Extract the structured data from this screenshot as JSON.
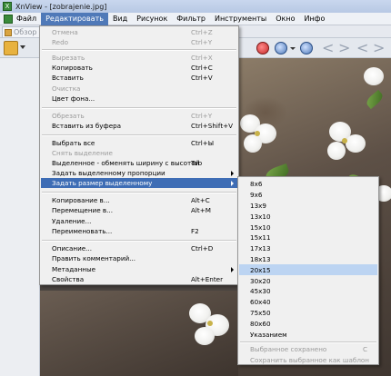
{
  "window": {
    "title": "XnView - [zobrajenie.jpg]"
  },
  "menubar": {
    "items": [
      {
        "label": "Файл",
        "active": false
      },
      {
        "label": "Редактировать",
        "active": true
      },
      {
        "label": "Вид",
        "active": false
      },
      {
        "label": "Рисунок",
        "active": false
      },
      {
        "label": "Фильтр",
        "active": false
      },
      {
        "label": "Инструменты",
        "active": false
      },
      {
        "label": "Окно",
        "active": false
      },
      {
        "label": "Инфо",
        "active": false
      }
    ]
  },
  "tabs": {
    "browser_label": "Обзор"
  },
  "edit_menu": {
    "undo": {
      "label": "Отмена",
      "shortcut": "Ctrl+Z"
    },
    "redo": {
      "label": "Redo",
      "shortcut": "Ctrl+Y"
    },
    "cut": {
      "label": "Вырезать",
      "shortcut": "Ctrl+X"
    },
    "copy": {
      "label": "Копировать",
      "shortcut": "Ctrl+C"
    },
    "paste": {
      "label": "Вставить",
      "shortcut": "Ctrl+V"
    },
    "clear": {
      "label": "Очистка"
    },
    "bg_color": {
      "label": "Цвет фона..."
    },
    "crop": {
      "label": "Обрезать",
      "shortcut": "Ctrl+Y"
    },
    "paste_clipboard": {
      "label": "Вставить из буфера",
      "shortcut": "Ctrl+Shift+V"
    },
    "select_all": {
      "label": "Выбрать все",
      "shortcut": "Ctrl+Ы"
    },
    "deselect": {
      "label": "Снять выделение"
    },
    "swap_selection": {
      "label": "Выделенное - обменять ширину с высотой",
      "shortcut": "Tab"
    },
    "set_ratio": {
      "label": "Задать выделенному пропорции"
    },
    "set_size": {
      "label": "Задать размер выделенному"
    },
    "copy_to": {
      "label": "Копирование в...",
      "shortcut": "Alt+C"
    },
    "move_to": {
      "label": "Перемещение в...",
      "shortcut": "Alt+M"
    },
    "delete": {
      "label": "Удаление..."
    },
    "rename": {
      "label": "Переименовать...",
      "shortcut": "F2"
    },
    "description": {
      "label": "Описание...",
      "shortcut": "Ctrl+D"
    },
    "edit_comment": {
      "label": "Править комментарий..."
    },
    "metadata": {
      "label": "Метаданные"
    },
    "properties": {
      "label": "Свойства",
      "shortcut": "Alt+Enter"
    }
  },
  "size_submenu": {
    "items": [
      "8x6",
      "9x6",
      "13x9",
      "13x10",
      "15x10",
      "15x11",
      "17x13",
      "18x13",
      "20x15",
      "30x20",
      "45x30",
      "60x40",
      "75x50",
      "80x60",
      "Указанием"
    ],
    "highlighted": "20x15",
    "saved_selected": {
      "label": "Выбранное сохранено",
      "shortcut": "C"
    },
    "save_as_template": {
      "label": "Сохранить выбранное как шаблон"
    }
  }
}
